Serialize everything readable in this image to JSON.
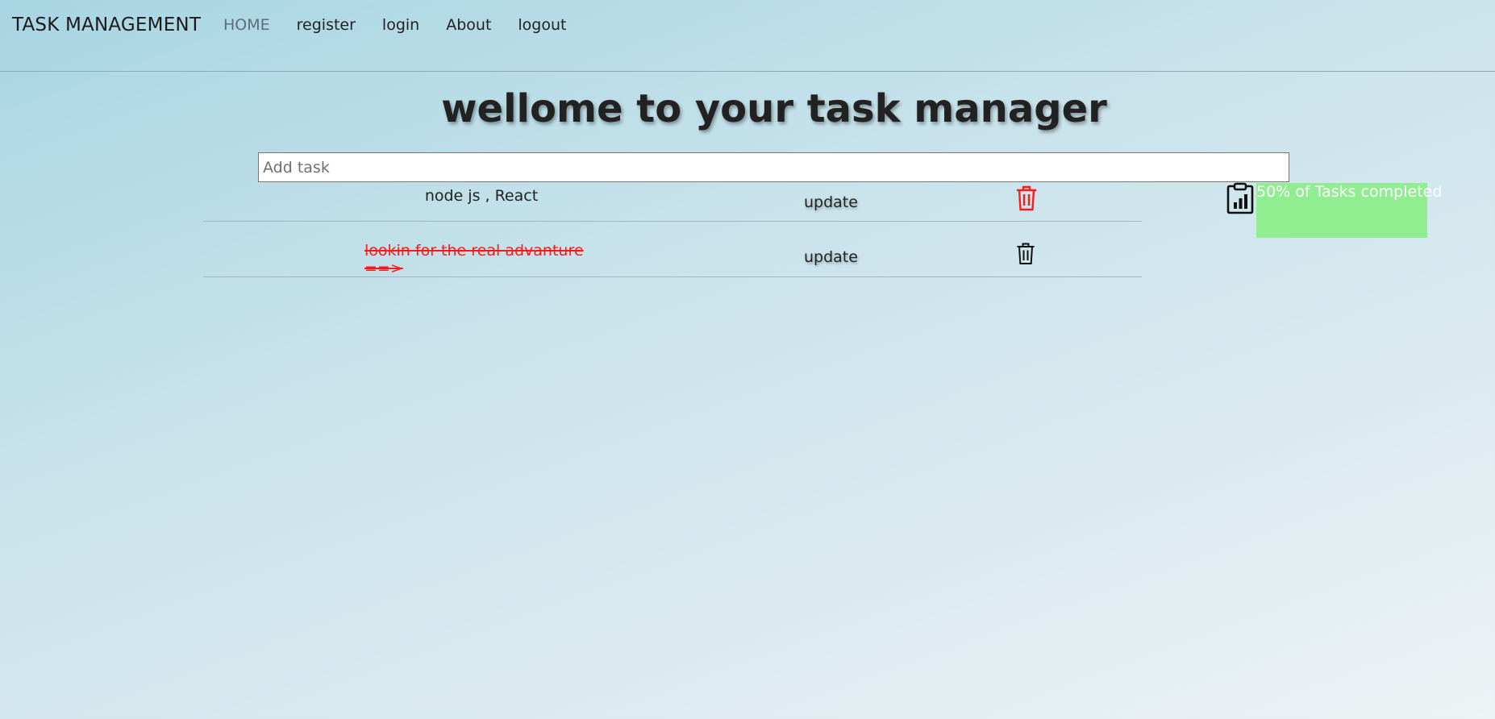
{
  "navbar": {
    "brand": "TASK MANAGEMENT",
    "links": [
      {
        "label": "HOME"
      },
      {
        "label": "register"
      },
      {
        "label": "login"
      },
      {
        "label": "About"
      },
      {
        "label": "logout"
      }
    ]
  },
  "title": "wellome to your task manager",
  "add_task": {
    "placeholder": "Add task",
    "value": ""
  },
  "tasks": [
    {
      "text": "node js , React",
      "update_label": "update",
      "completed": false,
      "delete_icon": "trash-icon",
      "delete_color": "#ff0000"
    },
    {
      "text": "lookin for the real advanture ==>",
      "update_label": "update",
      "completed": true,
      "delete_icon": "trash-icon",
      "delete_color": "#111111"
    }
  ],
  "stats": {
    "icon": "clipboard-chart-icon",
    "percent_completed": 50,
    "label": "50% of Tasks completed",
    "color": "#90ee90"
  }
}
